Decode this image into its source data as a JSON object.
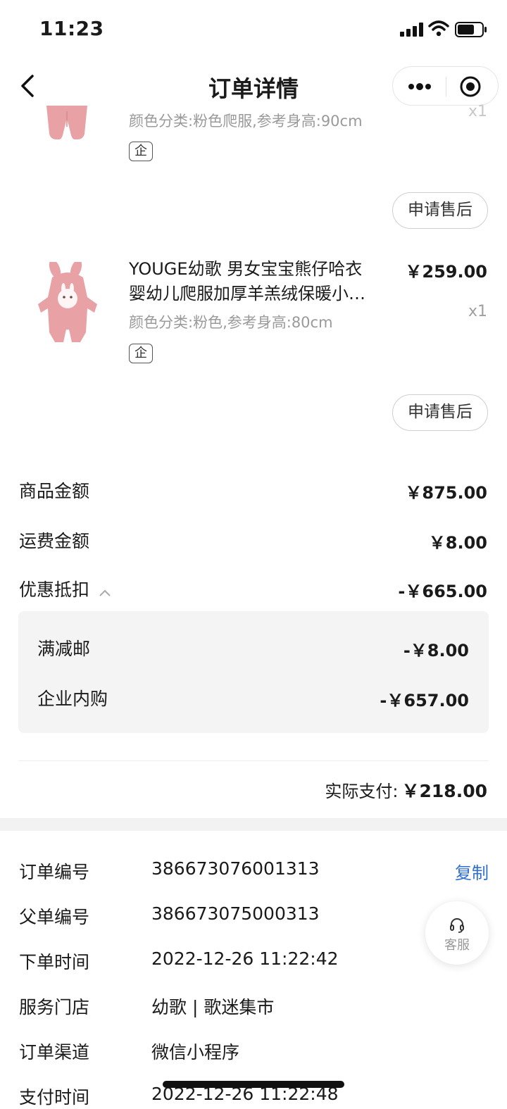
{
  "status_bar": {
    "time": "11:23"
  },
  "nav": {
    "title": "订单详情"
  },
  "products": [
    {
      "spec": "颜色分类:粉色爬服,参考身高:90cm",
      "qty": "x1",
      "tag": "企",
      "after_sale_label": "申请售后"
    },
    {
      "title_line1": "YOUGE幼歌 男女宝宝熊仔哈衣",
      "title_line2": "婴幼儿爬服加厚羊羔绒保暖小…",
      "spec": "颜色分类:粉色,参考身高:80cm",
      "price": "￥259.00",
      "qty": "x1",
      "tag": "企",
      "after_sale_label": "申请售后"
    }
  ],
  "amounts": {
    "goods_label": "商品金额",
    "goods_value": "￥875.00",
    "shipping_label": "运费金额",
    "shipping_value": "￥8.00",
    "discount_label": "优惠抵扣",
    "discount_value": "-￥665.00",
    "discount_items": [
      {
        "label": "满减邮",
        "value": "-￥8.00"
      },
      {
        "label": "企业内购",
        "value": "-￥657.00"
      }
    ],
    "paid_label": "实际支付:",
    "paid_value": "￥218.00"
  },
  "order_info": {
    "order_no_label": "订单编号",
    "order_no": "386673076001313",
    "copy_label": "复制",
    "parent_no_label": "父单编号",
    "parent_no": "386673075000313",
    "order_time_label": "下单时间",
    "order_time": "2022-12-26 11:22:42",
    "store_label": "服务门店",
    "store": "幼歌 | 歌迷集市",
    "channel_label": "订单渠道",
    "channel": "微信小程序",
    "pay_time_label": "支付时间",
    "pay_time": "2022-12-26 11:22:48"
  },
  "service": {
    "label": "客服"
  },
  "colors": {
    "link": "#2f6ed3",
    "product_pink": "#e8a2a6",
    "panel_bg": "#f4f4f4"
  }
}
